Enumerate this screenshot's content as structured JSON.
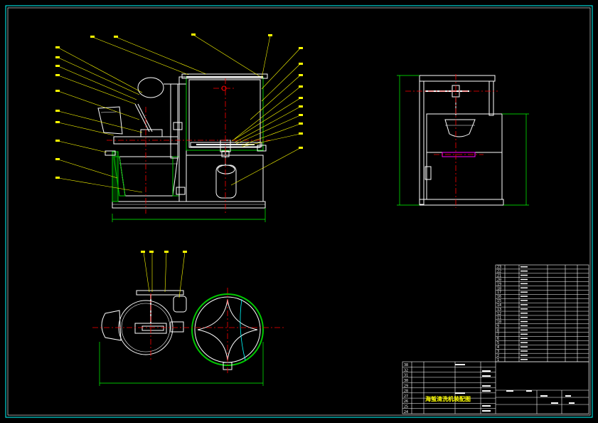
{
  "colors": {
    "background": "#000000",
    "outline": "#ffffff",
    "centerline": "#ff0000",
    "leader": "#ffff00",
    "hatch": "#00c800",
    "dimension": "#00ff00",
    "cyan": "#00ffff",
    "magenta": "#ff00ff",
    "blue": "#5a6cff"
  },
  "title_block": {
    "drawing_title": "海蜇清洗机装配图"
  },
  "parts_list": {
    "upper_numbers": [
      "23",
      "22",
      "21",
      "20",
      "19",
      "18",
      "17",
      "16",
      "15",
      "14",
      "13",
      "12",
      "11",
      "10",
      "9",
      "8",
      "7",
      "6",
      "5",
      "4",
      "3",
      "2",
      "1"
    ],
    "lower_numbers": [
      "38",
      "32",
      "31",
      "30",
      "29",
      "28",
      "27",
      "26",
      "25",
      "24"
    ]
  }
}
